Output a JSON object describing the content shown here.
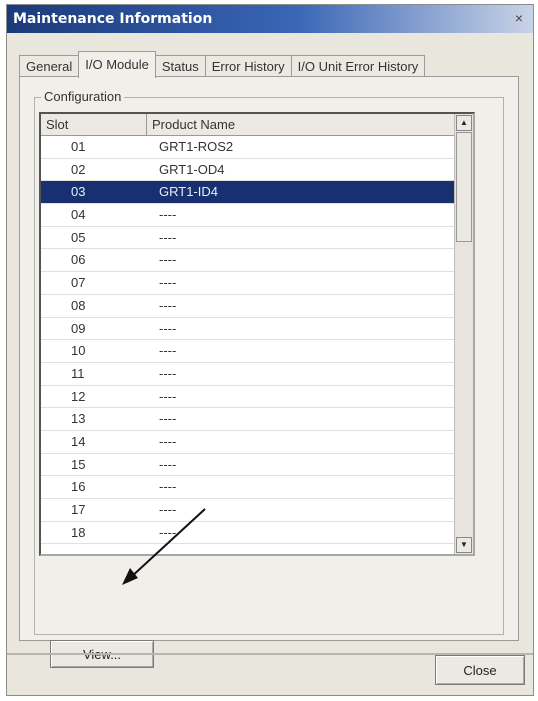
{
  "window": {
    "title": "Maintenance Information",
    "close_glyph": "×"
  },
  "tabs": [
    {
      "label": "General"
    },
    {
      "label": "I/O Module",
      "active": true
    },
    {
      "label": "Status"
    },
    {
      "label": "Error History"
    },
    {
      "label": "I/O Unit Error History"
    }
  ],
  "group": {
    "label": "Configuration"
  },
  "table": {
    "columns": [
      "Slot",
      "Product Name"
    ],
    "rows": [
      {
        "slot": "01",
        "name": "GRT1-ROS2"
      },
      {
        "slot": "02",
        "name": "GRT1-OD4"
      },
      {
        "slot": "03",
        "name": "GRT1-ID4",
        "selected": true
      },
      {
        "slot": "04",
        "name": "----"
      },
      {
        "slot": "05",
        "name": "----"
      },
      {
        "slot": "06",
        "name": "----"
      },
      {
        "slot": "07",
        "name": "----"
      },
      {
        "slot": "08",
        "name": "----"
      },
      {
        "slot": "09",
        "name": "----"
      },
      {
        "slot": "10",
        "name": "----"
      },
      {
        "slot": "11",
        "name": "----"
      },
      {
        "slot": "12",
        "name": "----"
      },
      {
        "slot": "13",
        "name": "----"
      },
      {
        "slot": "14",
        "name": "----"
      },
      {
        "slot": "15",
        "name": "----"
      },
      {
        "slot": "16",
        "name": "----"
      },
      {
        "slot": "17",
        "name": "----"
      },
      {
        "slot": "18",
        "name": "----"
      }
    ]
  },
  "buttons": {
    "view": "View...",
    "close": "Close"
  },
  "icons": {
    "scroll_up": "scroll-up-arrow-icon",
    "scroll_down": "scroll-down-arrow-icon",
    "pointer": "annotation-arrow"
  },
  "colors": {
    "selected_row": "#18306f",
    "titlebar": "#1b3a7a"
  }
}
